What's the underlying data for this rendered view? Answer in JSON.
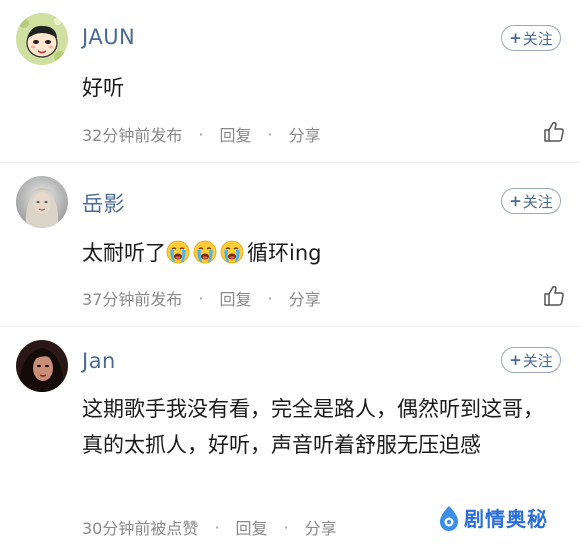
{
  "comments": [
    {
      "username": "JAUN",
      "follow_label": "关注",
      "follow_plus": "+",
      "content": "好听",
      "time": "32分钟前发布",
      "reply": "回复",
      "share": "分享",
      "separator": "·"
    },
    {
      "username": "岳影",
      "follow_label": "关注",
      "follow_plus": "+",
      "content_prefix": "太耐听了",
      "content_emojis": [
        "crying-face",
        "crying-face",
        "crying-face"
      ],
      "content_suffix": "循环ing",
      "time": "37分钟前发布",
      "reply": "回复",
      "share": "分享",
      "separator": "·"
    },
    {
      "username": "Jan",
      "follow_label": "关注",
      "follow_plus": "+",
      "content": "这期歌手我没有看，完全是路人，偶然听到这哥，真的太抓人，好听，声音听着舒服无压迫感",
      "time": "30分钟前被点赞",
      "reply": "回复",
      "share": "分享",
      "separator": "·"
    }
  ],
  "watermark": {
    "text": "剧情奥秘",
    "icon": "brand-logo-icon"
  },
  "colors": {
    "username": "#4a6a96",
    "meta": "#8a8a8a",
    "follow_border": "#9aa8bd",
    "watermark": "#2a6fd8"
  }
}
